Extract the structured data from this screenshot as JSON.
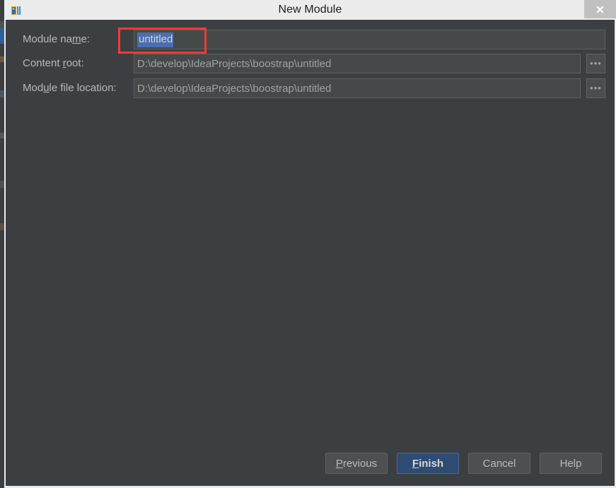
{
  "window": {
    "title": "New Module",
    "app_icon": "intellij-idea-icon",
    "close_label": "✕"
  },
  "form": {
    "rows": [
      {
        "label_pre": "Module na",
        "label_mnemonic": "m",
        "label_post": "e:",
        "label_full": "Module name:",
        "value": "untitled",
        "selected": true,
        "has_browse": false
      },
      {
        "label_pre": "Content ",
        "label_mnemonic": "r",
        "label_post": "oot:",
        "label_full": "Content root:",
        "value": "D:\\develop\\IdeaProjects\\boostrap\\untitled",
        "selected": false,
        "has_browse": true,
        "browse_label": "•••"
      },
      {
        "label_pre": "Mod",
        "label_mnemonic": "u",
        "label_post": "le file location:",
        "label_full": "Module file location:",
        "value": "D:\\develop\\IdeaProjects\\boostrap\\untitled",
        "selected": false,
        "has_browse": true,
        "browse_label": "•••"
      }
    ]
  },
  "annotation": {
    "shape": "rectangle",
    "color": "#f23b32",
    "targets": "module-name-field"
  },
  "footer": {
    "buttons": [
      {
        "pre": "",
        "mnemonic": "P",
        "post": "revious",
        "full": "Previous",
        "primary": false
      },
      {
        "pre": "",
        "mnemonic": "F",
        "post": "inish",
        "full": "Finish",
        "primary": true
      },
      {
        "pre": "Cancel",
        "mnemonic": "",
        "post": "",
        "full": "Cancel",
        "primary": false
      },
      {
        "pre": "Help",
        "mnemonic": "",
        "post": "",
        "full": "Help",
        "primary": false
      }
    ]
  },
  "colors": {
    "titlebar_bg": "#ececec",
    "dialog_bg": "#3c3f41",
    "field_bg": "#45494a",
    "selection_blue": "#4b6eaf",
    "primary_button": "#2e4b72",
    "annotation_red": "#f23b32",
    "text_secondary": "#b9b9b9"
  }
}
